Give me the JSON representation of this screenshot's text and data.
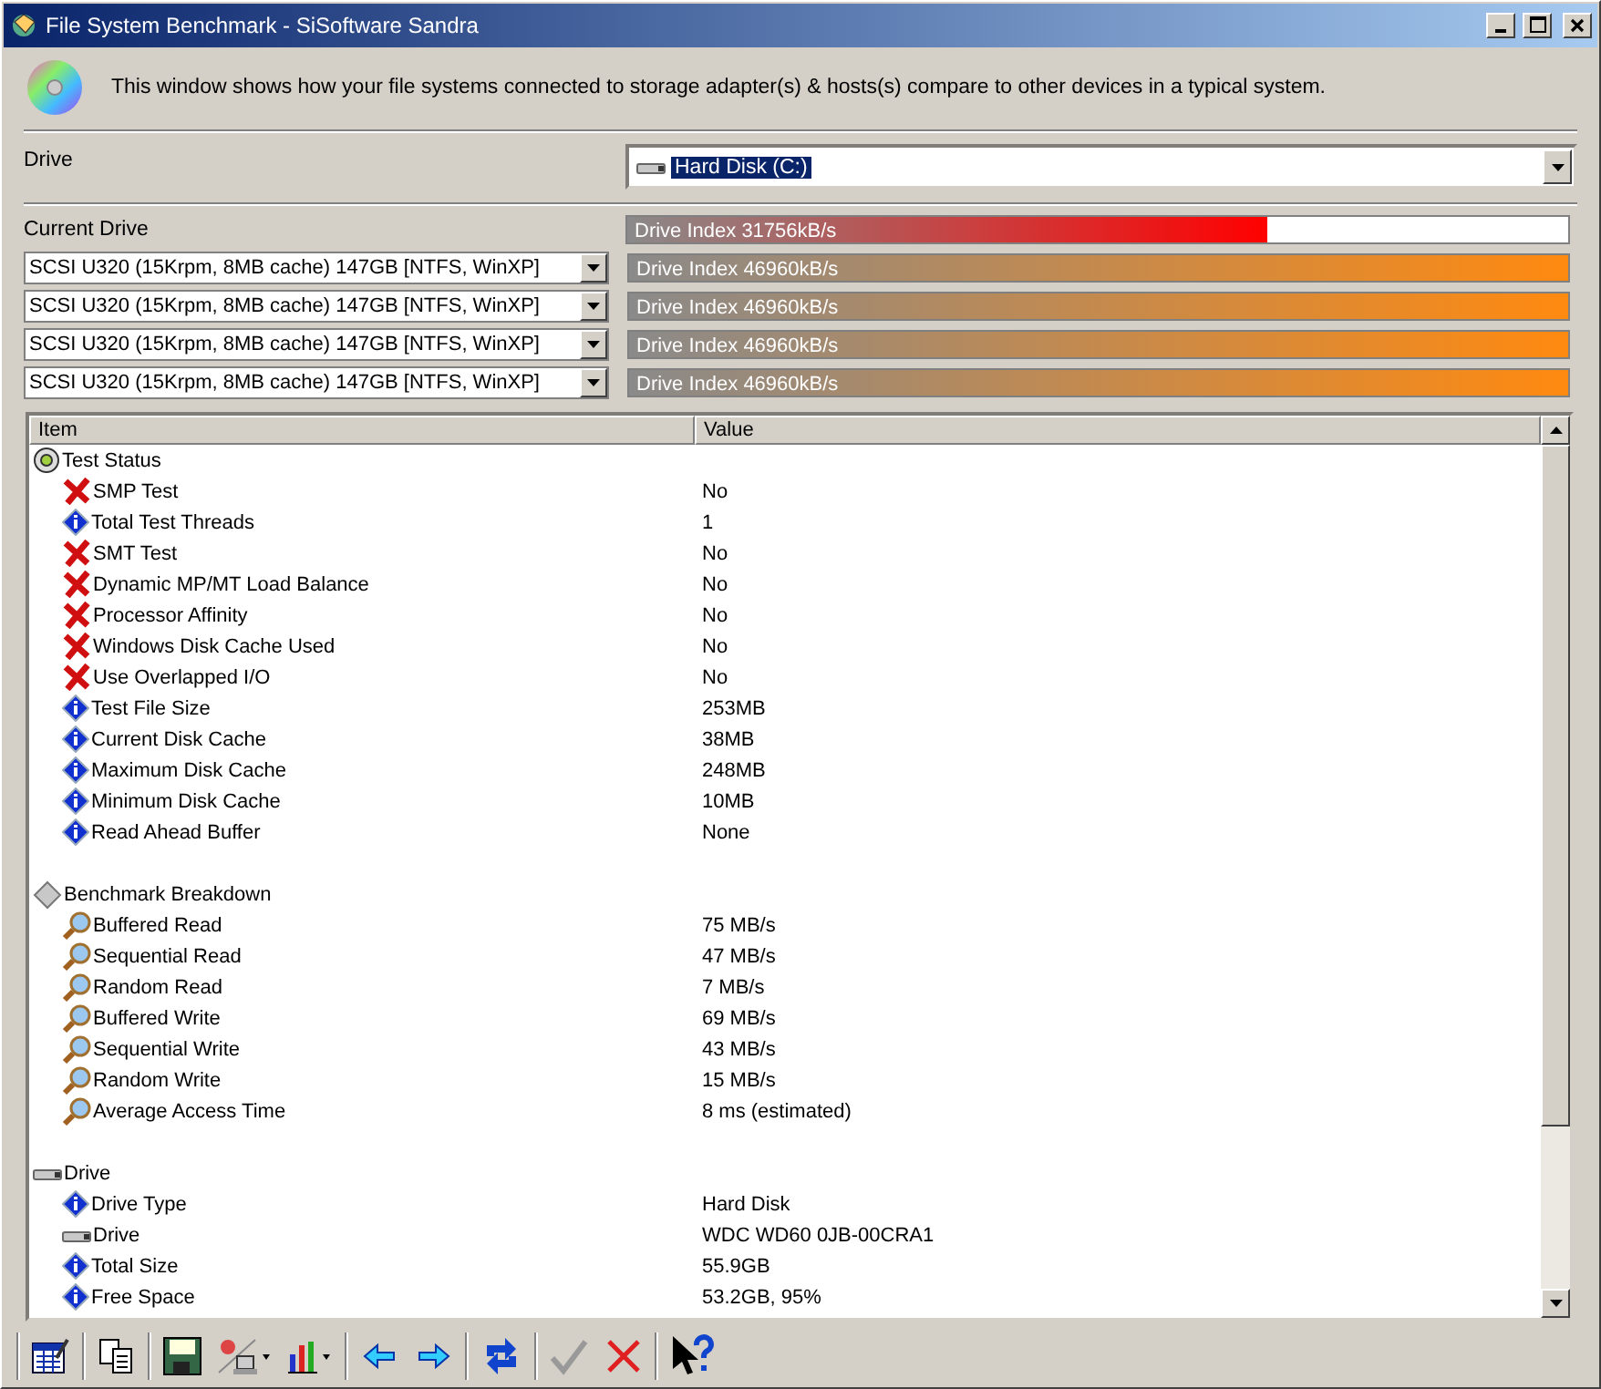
{
  "window": {
    "title": "File System Benchmark - SiSoftware Sandra"
  },
  "header": {
    "description": "This window shows how your file systems connected to storage adapter(s) & hosts(s) compare to other devices in a typical system."
  },
  "drive": {
    "label": "Drive",
    "value": "Hard Disk (C:)"
  },
  "current": {
    "label": "Current Drive",
    "bar": {
      "text": "Drive Index 31756kB/s",
      "level": 0.68
    }
  },
  "comparisons": [
    {
      "device": "SCSI U320 (15Krpm, 8MB cache) 147GB [NTFS, WinXP]",
      "bar": {
        "text": "Drive Index 46960kB/s",
        "level": 1
      }
    },
    {
      "device": "SCSI U320 (15Krpm, 8MB cache) 147GB [NTFS, WinXP]",
      "bar": {
        "text": "Drive Index 46960kB/s",
        "level": 1
      }
    },
    {
      "device": "SCSI U320 (15Krpm, 8MB cache) 147GB [NTFS, WinXP]",
      "bar": {
        "text": "Drive Index 46960kB/s",
        "level": 1
      }
    },
    {
      "device": "SCSI U320 (15Krpm, 8MB cache) 147GB [NTFS, WinXP]",
      "bar": {
        "text": "Drive Index 46960kB/s",
        "level": 1
      }
    }
  ],
  "table": {
    "columns": [
      "Item",
      "Value"
    ],
    "groups": [
      {
        "kind": "disc",
        "label": "Test Status",
        "children": [
          {
            "kind": "cross",
            "item": "SMP Test",
            "value": "No"
          },
          {
            "kind": "info",
            "item": "Total Test Threads",
            "value": "1"
          },
          {
            "kind": "cross",
            "item": "SMT Test",
            "value": "No"
          },
          {
            "kind": "cross",
            "item": "Dynamic MP/MT Load Balance",
            "value": "No"
          },
          {
            "kind": "cross",
            "item": "Processor Affinity",
            "value": "No"
          },
          {
            "kind": "cross",
            "item": "Windows Disk Cache Used",
            "value": "No"
          },
          {
            "kind": "cross",
            "item": "Use Overlapped I/O",
            "value": "No"
          },
          {
            "kind": "info",
            "item": "Test File Size",
            "value": "253MB"
          },
          {
            "kind": "info",
            "item": "Current Disk Cache",
            "value": "38MB"
          },
          {
            "kind": "info",
            "item": "Maximum Disk Cache",
            "value": "248MB"
          },
          {
            "kind": "info",
            "item": "Minimum Disk Cache",
            "value": "10MB"
          },
          {
            "kind": "info",
            "item": "Read Ahead Buffer",
            "value": "None"
          }
        ]
      },
      {
        "kind": "diamond",
        "label": "Benchmark Breakdown",
        "children": [
          {
            "kind": "magnifier",
            "item": "Buffered Read",
            "value": "75 MB/s"
          },
          {
            "kind": "magnifier",
            "item": "Sequential Read",
            "value": "47 MB/s"
          },
          {
            "kind": "magnifier",
            "item": "Random Read",
            "value": "7 MB/s"
          },
          {
            "kind": "magnifier",
            "item": "Buffered Write",
            "value": "69 MB/s"
          },
          {
            "kind": "magnifier",
            "item": "Sequential Write",
            "value": "43 MB/s"
          },
          {
            "kind": "magnifier",
            "item": "Random Write",
            "value": "15 MB/s"
          },
          {
            "kind": "magnifier",
            "item": "Average Access Time",
            "value": "8 ms (estimated)"
          }
        ]
      },
      {
        "kind": "drive",
        "label": "Drive",
        "children": [
          {
            "kind": "info",
            "item": "Drive Type",
            "value": "Hard Disk"
          },
          {
            "kind": "drive",
            "item": "Drive",
            "value": "WDC WD60 0JB-00CRA1"
          },
          {
            "kind": "info",
            "item": "Total Size",
            "value": "55.9GB"
          },
          {
            "kind": "info",
            "item": "Free Space",
            "value": "53.2GB, 95%"
          }
        ]
      }
    ]
  }
}
